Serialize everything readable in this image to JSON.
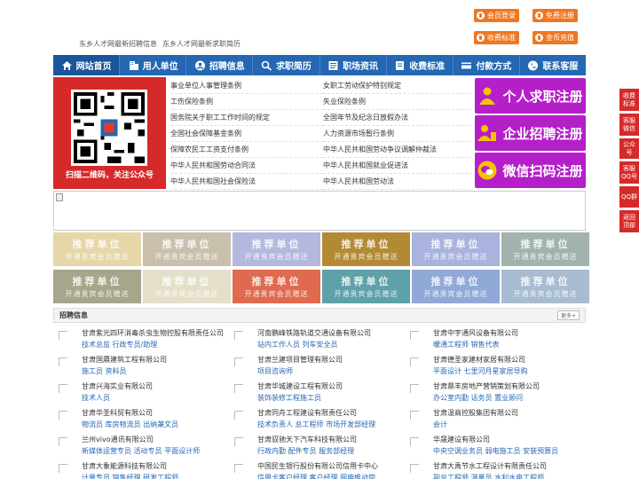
{
  "header": {
    "top_links": [
      "东乡人才网最新招聘信息",
      "东乡人才网最新求职简历"
    ],
    "buttons": [
      "会员登录",
      "免费注册",
      "收费标准",
      "金币充值"
    ]
  },
  "nav": {
    "items": [
      "网站首页",
      "用人单位",
      "招聘信息",
      "求职简历",
      "职场资讯",
      "收费标准",
      "付款方式",
      "联系客服"
    ]
  },
  "banner": {
    "qr_caption": "扫描二维码，关注公众号",
    "links": [
      "事业单位人事管理条例",
      "女职工劳动保护特别规定",
      "工伤保险条例",
      "失业保险条例",
      "国务院关于职工工作时间的规定",
      "全国年节及纪念日放假办法",
      "全国社会保障基金条例",
      "人力资源市场暂行条例",
      "保障农民工工资支付条例",
      "中华人民共和国劳动争议调解仲裁法",
      "中华人民共和国劳动合同法",
      "中华人民共和国就业促进法",
      "中华人民共和国社会保险法",
      "中华人民共和国劳动法"
    ],
    "register_buttons": [
      "个人求职注册",
      "企业招聘注册",
      "微信扫码注册"
    ]
  },
  "recommend": {
    "title": "推荐单位",
    "subtitle": "开通贵宾会员赠送",
    "colors": [
      "#e6d6a8",
      "#c8c0ac",
      "#b3b8de",
      "#b38a34",
      "#a9b3dd",
      "#a2b3ae",
      "#a6a68c",
      "#e4dfc9",
      "#e06a4f",
      "#5ea1a8",
      "#91a9d6",
      "#a8bcd1"
    ]
  },
  "jobs": {
    "title": "招聘信息",
    "more": "更多+",
    "items": [
      {
        "company": "甘肃紫光四环消毒杀虫生物控股有限责任公司",
        "positions": "技术总监 行政专员/助理"
      },
      {
        "company": "河南鹏峰铁路轨道交通设备有限公司",
        "positions": "站内工作人员 列车安全员"
      },
      {
        "company": "甘肃中宇通风设备有限公司",
        "positions": "暖通工程师 销售代表"
      },
      {
        "company": "甘肃国赓建筑工程有限公司",
        "positions": "施工员 资料员"
      },
      {
        "company": "甘肃兰建项目管理有限公司",
        "positions": "项目咨询师"
      },
      {
        "company": "甘肃德圣家建材家居有限公司",
        "positions": "平面设计 七里河月星家居导购"
      },
      {
        "company": "甘肃兴海实业有限公司",
        "positions": "技术人员"
      },
      {
        "company": "甘肃华城建设工程有限公司",
        "positions": "装饰装修工程施工员"
      },
      {
        "company": "甘肃鼎丰房地产营销策划有限公司",
        "positions": "办公室内勤 话务员 置业顾问"
      },
      {
        "company": "甘肃华圣科贸有限公司",
        "positions": "物流员 库房物流员 出纳兼文员"
      },
      {
        "company": "甘肃同舟工程建设有限责任公司",
        "positions": "技术负责人 总工程师 市场开发部经理"
      },
      {
        "company": "甘肃温商控股集团有限公司",
        "positions": "会计"
      },
      {
        "company": "兰州vivo通讯有限公司",
        "positions": "新媒体运营专员 活动专员 平面设计师"
      },
      {
        "company": "甘肃驭驰天下汽车科技有限公司",
        "positions": "行政内勤 配件专员 服务部经理"
      },
      {
        "company": "华晟建设有限公司",
        "positions": "中央空调业务员 弱电施工员 安装预算员"
      },
      {
        "company": "甘肃大象能源科技有限公司",
        "positions": "计量专员 销售经理 研发工程师"
      },
      {
        "company": "中国民生银行股份有限公司信用卡中心",
        "positions": "信用卡客户经理 客户经理 网申推动岗"
      },
      {
        "company": "甘肃大禹节水工程设计有限责任公司",
        "positions": "副总工程师 测量员 水利水电工程师"
      }
    ]
  },
  "sidebar": {
    "items": [
      "收费标准",
      "客服微信",
      "公众号",
      "客服QQ号",
      "QQ群",
      "返回顶部"
    ]
  }
}
